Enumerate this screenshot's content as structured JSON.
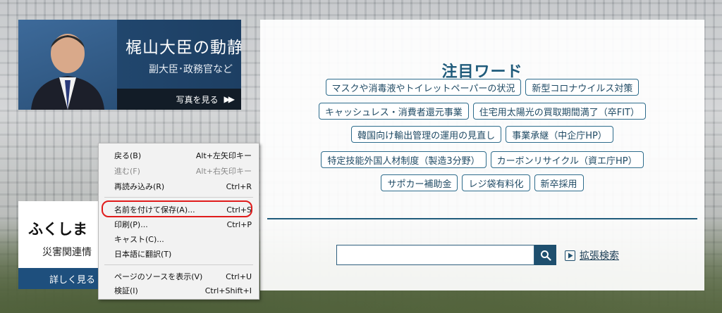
{
  "banner": {
    "title": "梶山大臣の動静",
    "subtitle": "副大臣･政務官など",
    "more_label": "写真を見る"
  },
  "fukushima": {
    "title": "ふくしま",
    "subtitle": "災害関連情",
    "button_label": "詳しく見る"
  },
  "keywords": {
    "title": "注目ワード",
    "rows": [
      [
        "マスクや消毒液やトイレットペーパーの状況",
        "新型コロナウイルス対策"
      ],
      [
        "キャッシュレス・消費者還元事業",
        "住宅用太陽光の買取期間満了（卒FIT）"
      ],
      [
        "韓国向け輸出管理の運用の見直し",
        "事業承継（中企庁HP）"
      ],
      [
        "特定技能外国人材制度（製造3分野）",
        "カーボンリサイクル（資エ庁HP）"
      ],
      [
        "サポカー補助金",
        "レジ袋有料化",
        "新卒採用"
      ]
    ]
  },
  "search": {
    "value": "",
    "advanced_label": "拡張検索"
  },
  "context_menu": {
    "items": [
      {
        "label": "戻る(B)",
        "shortcut": "Alt+左矢印キー",
        "disabled": false
      },
      {
        "label": "進む(F)",
        "shortcut": "Alt+右矢印キー",
        "disabled": true
      },
      {
        "label": "再読み込み(R)",
        "shortcut": "Ctrl+R",
        "disabled": false
      },
      {
        "label": "名前を付けて保存(A)...",
        "shortcut": "Ctrl+S",
        "disabled": false
      },
      {
        "label": "印刷(P)...",
        "shortcut": "Ctrl+P",
        "disabled": false
      },
      {
        "label": "キャスト(C)...",
        "shortcut": "",
        "disabled": false
      },
      {
        "label": "日本語に翻訳(T)",
        "shortcut": "",
        "disabled": false
      },
      {
        "label": "ページのソースを表示(V)",
        "shortcut": "Ctrl+U",
        "disabled": false
      },
      {
        "label": "検証(I)",
        "shortcut": "Ctrl+Shift+I",
        "disabled": false
      }
    ]
  },
  "colors": {
    "accent": "#1f5b7b",
    "highlight": "#e01b1b",
    "banner": "#1c3a5c"
  },
  "icons": {
    "search": "search-icon",
    "advanced": "play-icon",
    "more": "double-chevron-right-icon"
  }
}
